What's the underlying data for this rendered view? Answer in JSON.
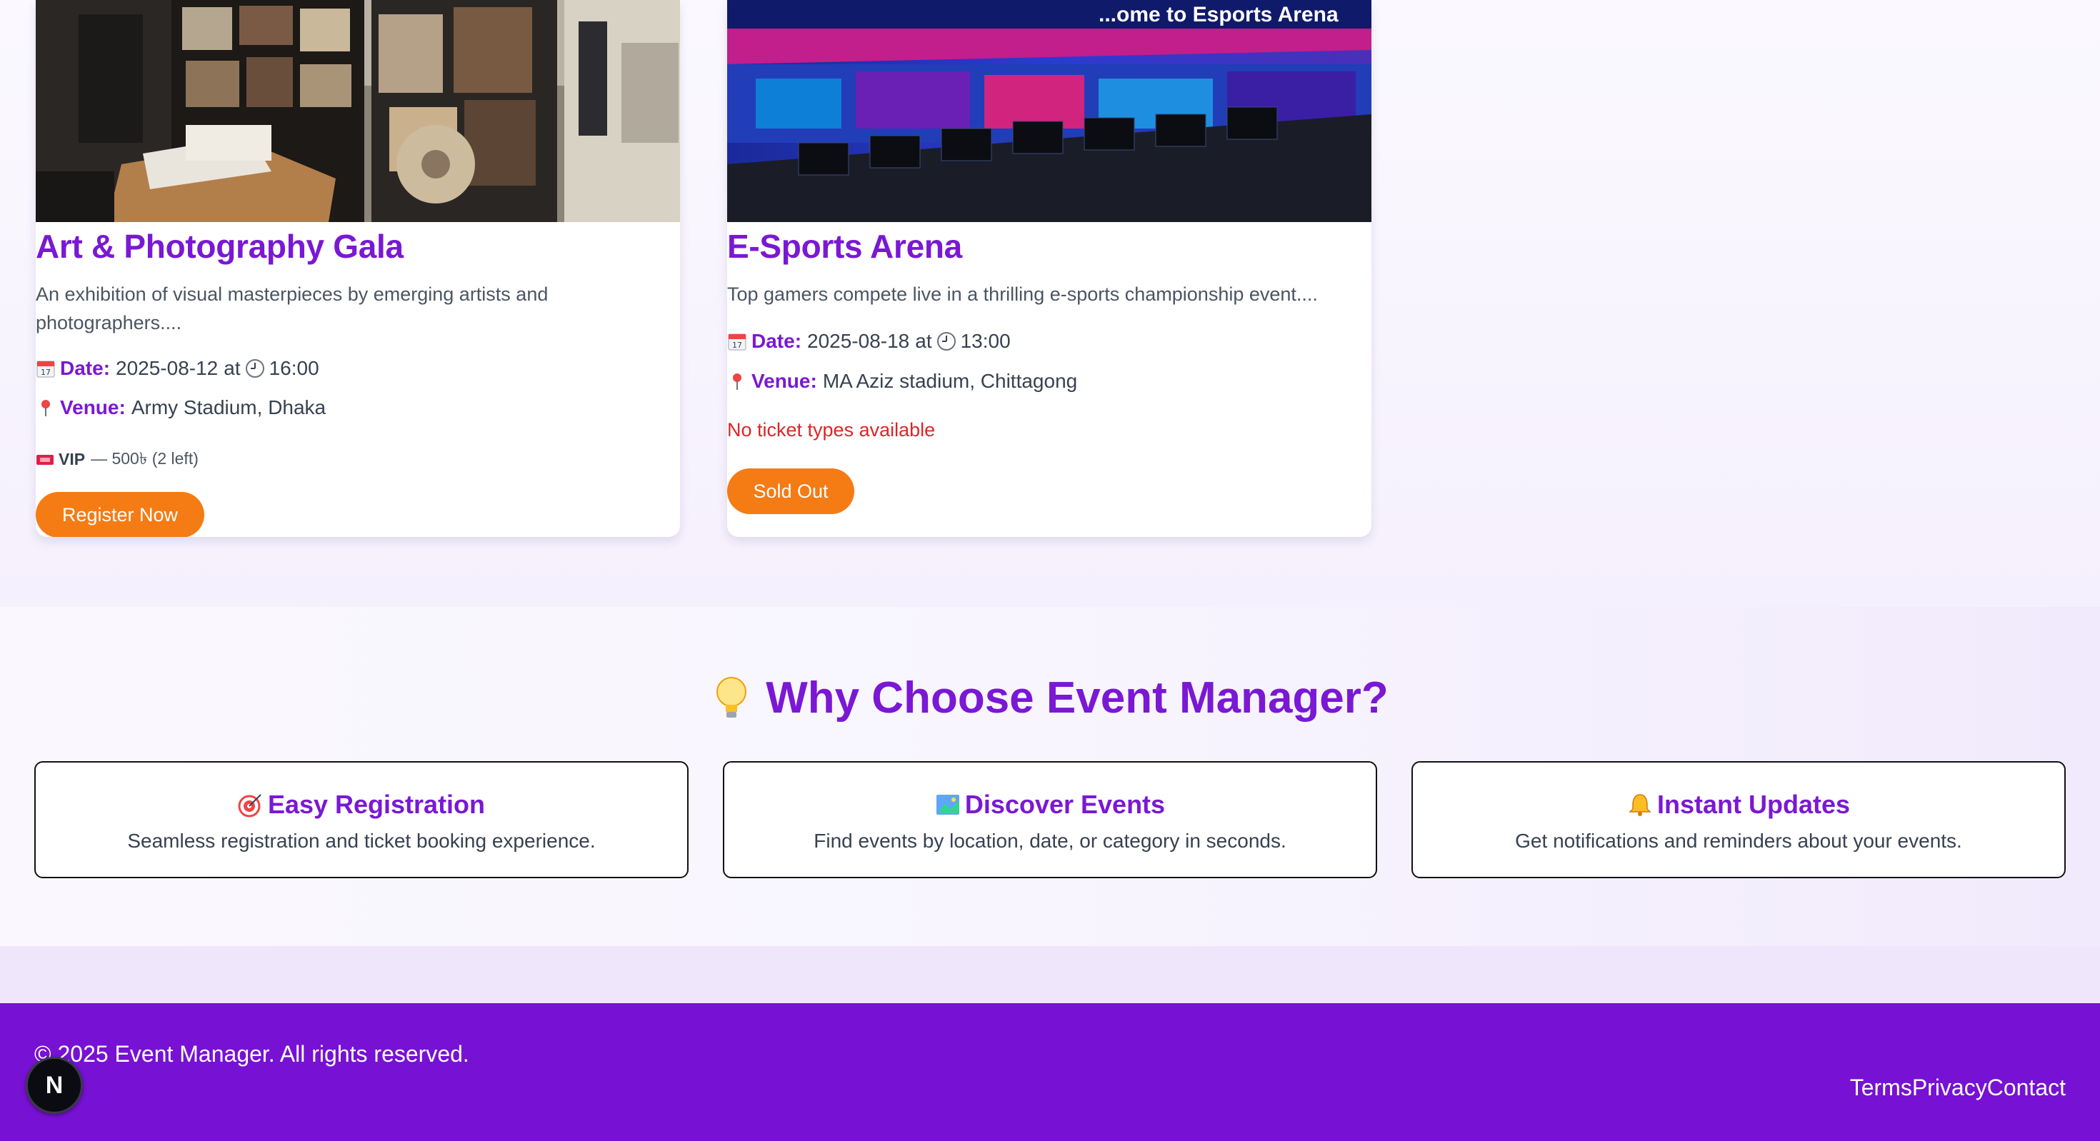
{
  "events": [
    {
      "title": "Art & Photography Gala",
      "description": "An exhibition of visual masterpieces by emerging artists and photographers....",
      "date_label": "Date:",
      "date": "2025-08-12",
      "at": "at",
      "time": "16:00",
      "venue_label": "Venue:",
      "venue": "Army Stadium, Dhaka",
      "ticket_name": "VIP",
      "ticket_detail": "— 500৳ (2 left)",
      "button": "Register Now",
      "image_icon": "art-gallery-photo"
    },
    {
      "title": "E-Sports Arena",
      "description": "Top gamers compete live in a thrilling e-sports championship event....",
      "date_label": "Date:",
      "date": "2025-08-18",
      "at": "at",
      "time": "13:00",
      "venue_label": "Venue:",
      "venue": "MA Aziz stadium, Chittagong",
      "no_tickets": "No ticket types available",
      "button": "Sold Out",
      "image_icon": "esports-arena-photo",
      "image_banner": "...ome to Esports Arena"
    }
  ],
  "why": {
    "title": "Why Choose Event Manager?",
    "icon": "lightbulb-icon",
    "features": [
      {
        "icon": "target-icon",
        "title": "Easy Registration",
        "desc": "Seamless registration and ticket booking experience."
      },
      {
        "icon": "map-icon",
        "title": "Discover Events",
        "desc": "Find events by location, date, or category in seconds."
      },
      {
        "icon": "bell-icon",
        "title": "Instant Updates",
        "desc": "Get notifications and reminders about your events."
      }
    ]
  },
  "footer": {
    "copyright": "© 2025 Event Manager. All rights reserved.",
    "links": [
      "Terms",
      "Privacy",
      "Contact"
    ]
  },
  "dev_badge": "N",
  "colors": {
    "accent": "#7a18d4",
    "button": "#f57b14",
    "footer_bg": "#7711d3",
    "error": "#dc2626"
  }
}
